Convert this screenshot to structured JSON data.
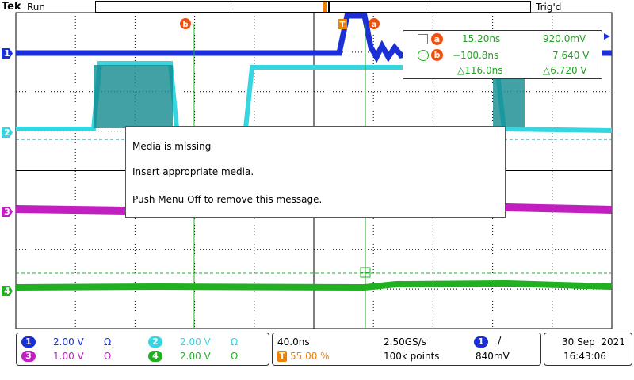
{
  "header": {
    "brand": "Tek",
    "run_state": "Run",
    "trigger_state": "Trig'd"
  },
  "channels": [
    {
      "number": "1",
      "color": "#1a2fd6",
      "scale": "2.00 V",
      "termination": "Ω"
    },
    {
      "number": "2",
      "color": "#36d6e0",
      "scale": "2.00 V",
      "termination": "Ω"
    },
    {
      "number": "3",
      "color": "#c020c0",
      "scale": "1.00 V",
      "termination": "Ω"
    },
    {
      "number": "4",
      "color": "#20b020",
      "scale": "2.00 V",
      "termination": "Ω"
    }
  ],
  "cursors": {
    "a_label": "a",
    "b_label": "b",
    "trigger_marker": "T",
    "readout": {
      "a_time": "15.20ns",
      "a_volt": "920.0mV",
      "b_time": "−100.8ns",
      "b_volt": "7.640 V",
      "delta_time": "△116.0ns",
      "delta_volt": "△6.720 V"
    }
  },
  "dialog": {
    "title": "Media is missing",
    "line1": "Insert appropriate media.",
    "line2": "Push Menu Off to remove this message."
  },
  "timebase": {
    "scale": "40.0ns",
    "sample_rate": "2.50GS/s",
    "trigger_position": "55.00 %",
    "record_length": "100k points"
  },
  "trigger": {
    "source": "1",
    "slope_symbol": "/",
    "level": "840mV"
  },
  "datetime": {
    "date": "30 Sep  2021",
    "time": "16:43:06"
  },
  "colors": {
    "cursor_accent": "#f05010",
    "trigger_orange": "#f08000",
    "grid": "#000000"
  }
}
